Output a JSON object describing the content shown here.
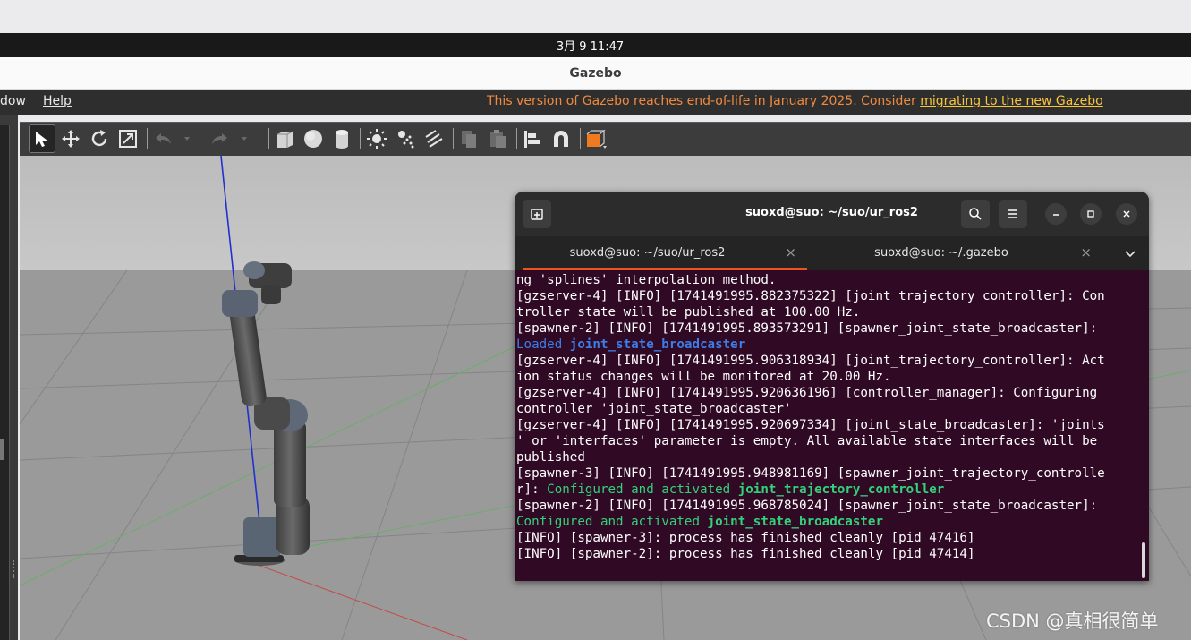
{
  "system_bar": {
    "datetime": "3月 9  11:47"
  },
  "window": {
    "title": "Gazebo"
  },
  "menu": {
    "items": [
      {
        "label": "dow"
      },
      {
        "label": "Help"
      }
    ],
    "notice_text": "This version of Gazebo reaches end-of-life in January 2025. Consider ",
    "notice_link": "migrating to the new Gazebo"
  },
  "toolbar": {
    "icons": [
      "select-arrow-icon",
      "translate-icon",
      "rotate-icon",
      "scale-icon",
      "undo-icon",
      "undo-dropdown-icon",
      "redo-icon",
      "redo-dropdown-icon",
      "box-shape-icon",
      "sphere-shape-icon",
      "cylinder-shape-icon",
      "point-light-icon",
      "spot-light-icon",
      "directional-light-icon",
      "copy-icon",
      "paste-icon",
      "align-icon",
      "snap-icon",
      "change-view-icon"
    ]
  },
  "terminal": {
    "title": "suoxd@suo: ~/suo/ur_ros2",
    "tabs": [
      {
        "label": "suoxd@suo: ~/suo/ur_ros2",
        "active": true
      },
      {
        "label": "suoxd@suo: ~/.gazebo",
        "active": false
      }
    ],
    "lines": [
      [
        {
          "t": "ng 'splines' interpolation method."
        }
      ],
      [
        {
          "t": "[gzserver-4] [INFO] [1741491995.882375322] [joint_trajectory_controller]: Con"
        }
      ],
      [
        {
          "t": "troller state will be published at 100.00 Hz."
        }
      ],
      [
        {
          "t": "[spawner-2] [INFO] [1741491995.893573291] [spawner_joint_state_broadcaster]:"
        }
      ],
      [
        {
          "t": "Loaded ",
          "c": "blue"
        },
        {
          "t": "joint_state_broadcaster",
          "c": "blue",
          "b": true
        }
      ],
      [
        {
          "t": "[gzserver-4] [INFO] [1741491995.906318934] [joint_trajectory_controller]: Act"
        }
      ],
      [
        {
          "t": "ion status changes will be monitored at 20.00 Hz."
        }
      ],
      [
        {
          "t": "[gzserver-4] [INFO] [1741491995.920636196] [controller_manager]: Configuring"
        }
      ],
      [
        {
          "t": "controller 'joint_state_broadcaster'"
        }
      ],
      [
        {
          "t": "[gzserver-4] [INFO] [1741491995.920697334] [joint_state_broadcaster]: 'joints"
        }
      ],
      [
        {
          "t": "' or 'interfaces' parameter is empty. All available state interfaces will be"
        }
      ],
      [
        {
          "t": "published"
        }
      ],
      [
        {
          "t": "[spawner-3] [INFO] [1741491995.948981169] [spawner_joint_trajectory_controlle"
        }
      ],
      [
        {
          "t": "r]: "
        },
        {
          "t": "Configured and activated ",
          "c": "green"
        },
        {
          "t": "joint_trajectory_controller",
          "c": "green",
          "b": true
        }
      ],
      [
        {
          "t": "[spawner-2] [INFO] [1741491995.968785024] [spawner_joint_state_broadcaster]:"
        }
      ],
      [
        {
          "t": "Configured and activated ",
          "c": "green"
        },
        {
          "t": "joint_state_broadcaster",
          "c": "green",
          "b": true
        }
      ],
      [
        {
          "t": "[INFO] [spawner-3]: process has finished cleanly [pid 47416]"
        }
      ],
      [
        {
          "t": "[INFO] [spawner-2]: process has finished cleanly [pid 47414]"
        }
      ]
    ]
  },
  "watermark": "CSDN @真相很简单",
  "colors": {
    "terminal_bg": "#300a24",
    "accent_orange": "#e95420",
    "log_blue": "#3d7de9",
    "log_green": "#33d17a",
    "notice_orange": "#f08a3e",
    "notice_link": "#f7c63d"
  }
}
